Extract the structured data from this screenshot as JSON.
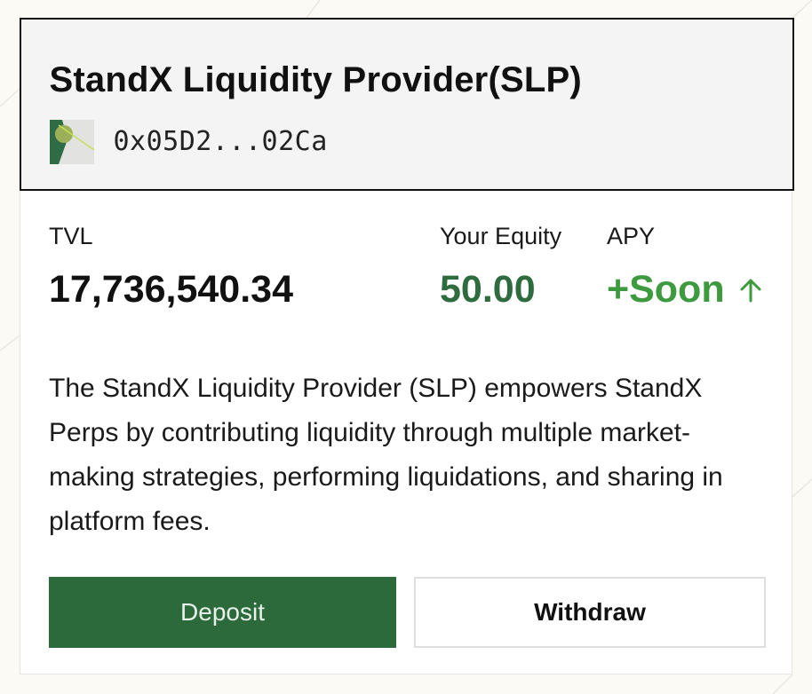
{
  "vault": {
    "title": "StandX Liquidity Provider(SLP)",
    "address": "0x05D2...02Ca",
    "avatar_icon": "generated-address-avatar"
  },
  "stats": {
    "tvl_label": "TVL",
    "tvl_value": "17,736,540.34",
    "equity_label": "Your Equity",
    "equity_value": "50.00",
    "apy_label": "APY",
    "apy_value": "+Soon",
    "apy_icon": "arrow-up-icon"
  },
  "description": "The StandX Liquidity Provider (SLP) empowers StandX Perps by contributing liquidity through multiple market-making strategies, performing liquidations, and sharing in platform fees.",
  "actions": {
    "deposit_label": "Deposit",
    "withdraw_label": "Withdraw"
  },
  "colors": {
    "accent_green": "#2c6a3c",
    "equity_green": "#2e6b3e",
    "apy_green": "#3e9a3f",
    "header_bg": "#f4f4f4",
    "page_bg": "#fbfaf5"
  }
}
